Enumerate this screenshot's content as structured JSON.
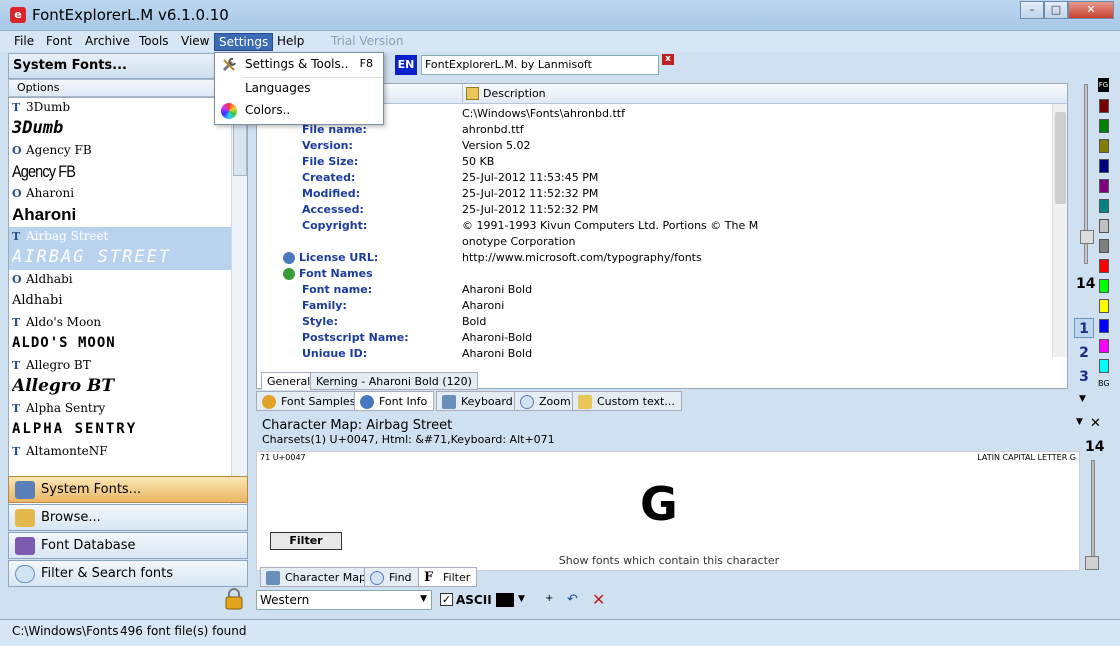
{
  "window": {
    "title": "FontExplorerL.M  v6.1.0.10",
    "controls": [
      "–",
      "□",
      "✕"
    ]
  },
  "menu": [
    "File",
    "Font",
    "Archive",
    "Tools",
    "View",
    "Settings",
    "Help",
    "Trial Version"
  ],
  "settings_menu": [
    {
      "label": "Settings & Tools..",
      "shortcut": "F8",
      "icon": "tools-icon"
    },
    {
      "label": "Languages",
      "shortcut": "",
      "icon": ""
    },
    {
      "label": "Colors..",
      "shortcut": "",
      "icon": "color-wheel-icon"
    }
  ],
  "left_panel": {
    "header": "System Fonts...",
    "options_label": "Options",
    "fonts": [
      {
        "name": "3Dumb",
        "type": "T",
        "sample": "3Dumb"
      },
      {
        "name": "Agency FB",
        "type": "O",
        "sample": "Agency FB"
      },
      {
        "name": "Aharoni",
        "type": "O",
        "sample": "Aharoni"
      },
      {
        "name": "Airbag Street",
        "type": "T",
        "sample": "AIRBAG STREET",
        "selected": true
      },
      {
        "name": "Aldhabi",
        "type": "O",
        "sample": "Aldhabi"
      },
      {
        "name": "Aldo's Moon",
        "type": "T",
        "sample": "ALDO'S MOON"
      },
      {
        "name": "Allegro BT",
        "type": "T",
        "sample": "Allegro BT"
      },
      {
        "name": "Alpha Sentry",
        "type": "T",
        "sample": "ALPHA SENTRY"
      },
      {
        "name": "AltamonteNF",
        "type": "T",
        "sample": ""
      }
    ],
    "nav": [
      "System Fonts...",
      "Browse...",
      "Font Database",
      "Filter & Search fonts"
    ]
  },
  "toolbar": {
    "language": "EN",
    "search_value": "FontExplorerL.M. by Lanmisoft"
  },
  "info": {
    "column_description": "Description",
    "rows": [
      {
        "k": "Path:",
        "v": "C:\\Windows\\Fonts\\ahronbd.ttf"
      },
      {
        "k": "File name:",
        "v": "ahronbd.ttf"
      },
      {
        "k": "Version:",
        "v": "Version 5.02"
      },
      {
        "k": "File Size:",
        "v": "50 KB"
      },
      {
        "k": "Created:",
        "v": "25-Jul-2012 11:53:45 PM"
      },
      {
        "k": "Modified:",
        "v": "25-Jul-2012 11:52:32 PM"
      },
      {
        "k": "Accessed:",
        "v": "25-Jul-2012 11:52:32 PM"
      },
      {
        "k": "Copyright:",
        "v": "© 1991-1993 Kivun Computers Ltd. Portions © The M"
      },
      {
        "k": "",
        "v": "onotype Corporation"
      },
      {
        "k": "License URL:",
        "v": "http://www.microsoft.com/typography/fonts",
        "section": true
      },
      {
        "k": "Font Names",
        "v": "",
        "section": true
      },
      {
        "k": "Font name:",
        "v": "Aharoni Bold"
      },
      {
        "k": "Family:",
        "v": "Aharoni"
      },
      {
        "k": "Style:",
        "v": "Bold"
      },
      {
        "k": "Postscript Name:",
        "v": "Aharoni-Bold"
      },
      {
        "k": "Unique ID:",
        "v": "Aharoni Bold"
      }
    ],
    "subtabs": [
      "General",
      "Kerning - Aharoni Bold (120)"
    ]
  },
  "main_tabs": [
    "Font Samples",
    "Font Info",
    "Keyboard",
    "Zoom",
    "Custom text..."
  ],
  "char_map": {
    "title": "Character Map:  Airbag Street",
    "subtitle": "Charsets(1)    U+0047, Html: &#71,Keyboard: Alt+071",
    "code": "71  U+0047",
    "char_name": "LATIN CAPITAL LETTER G",
    "glyph": "G",
    "filter_label": "Filter",
    "hint": "Show fonts which contain this character",
    "size": "14",
    "tabs": [
      "Character Map",
      "Find",
      "Filter"
    ]
  },
  "bottom": {
    "charset": "Western",
    "ascii_label": "ASCII",
    "ascii_checked": "✓"
  },
  "right_panel": {
    "fg_label": "FG",
    "bg_label": "BG",
    "zoom_value": "14",
    "pages": [
      "1",
      "2",
      "3"
    ],
    "swatches": [
      "#7a0000",
      "#008000",
      "#808000",
      "#000080",
      "#800080",
      "#008080",
      "#c0c0c0",
      "#808080",
      "#ff0000",
      "#00ff00",
      "#ffff00",
      "#0000ff",
      "#ff00ff",
      "#00ffff"
    ]
  },
  "status": {
    "path": "C:\\Windows\\Fonts",
    "count": "496  font file(s) found"
  }
}
